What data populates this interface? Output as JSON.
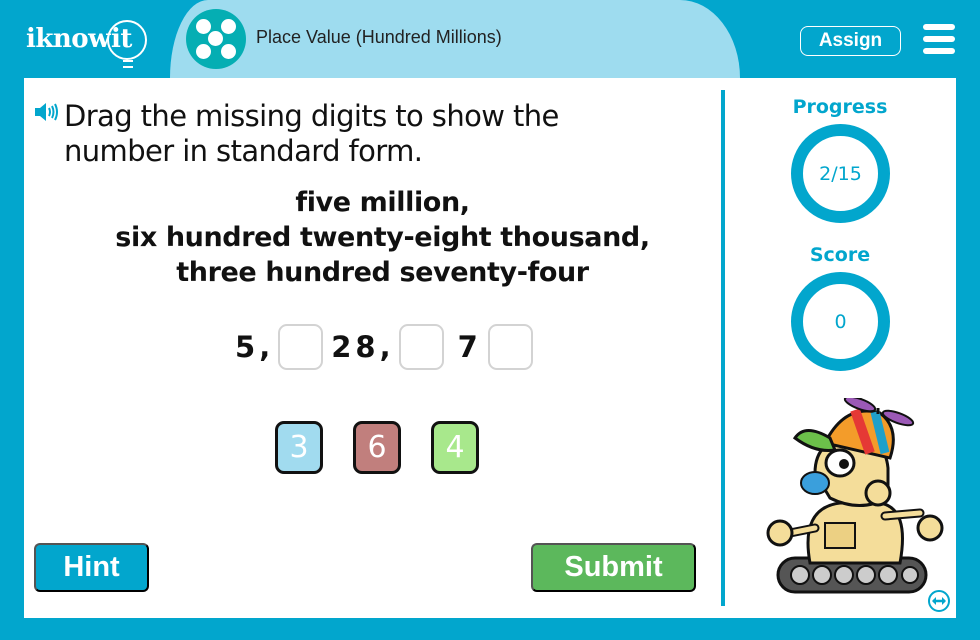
{
  "header": {
    "logo_text": "iknow",
    "logo_suffix": "it",
    "lesson_title": "Place Value (Hundred Millions)",
    "assign_label": "Assign",
    "menu_icon": "hamburger-menu-icon",
    "lesson_icon": "five-dots-icon"
  },
  "question": {
    "audio_icon": "speaker-icon",
    "instruction": "Drag the missing digits to show the number in standard form.",
    "prompt_lines": [
      "five million,",
      "six hundred twenty-eight thousand,",
      "three hundred seventy-four"
    ],
    "number_parts": {
      "d1": "5",
      "c1": ",",
      "d3": "2",
      "d4": "8",
      "c2": ",",
      "d6": "7"
    },
    "slots": [
      "",
      "",
      ""
    ],
    "tiles": [
      {
        "value": "3",
        "color": "#a1dbef"
      },
      {
        "value": "6",
        "color": "#c17f7d"
      },
      {
        "value": "4",
        "color": "#a8e88c"
      }
    ]
  },
  "buttons": {
    "hint_label": "Hint",
    "submit_label": "Submit"
  },
  "sidebar": {
    "progress_label": "Progress",
    "progress_value": "2/15",
    "score_label": "Score",
    "score_value": "0",
    "mascot": "robot-mascot",
    "swap_icon": "swap-horizontal-icon"
  },
  "colors": {
    "brand_blue": "#02a6cd",
    "title_band": "#9edcef",
    "lesson_icon_teal": "#05aeb3",
    "submit_green": "#5cb85c"
  }
}
